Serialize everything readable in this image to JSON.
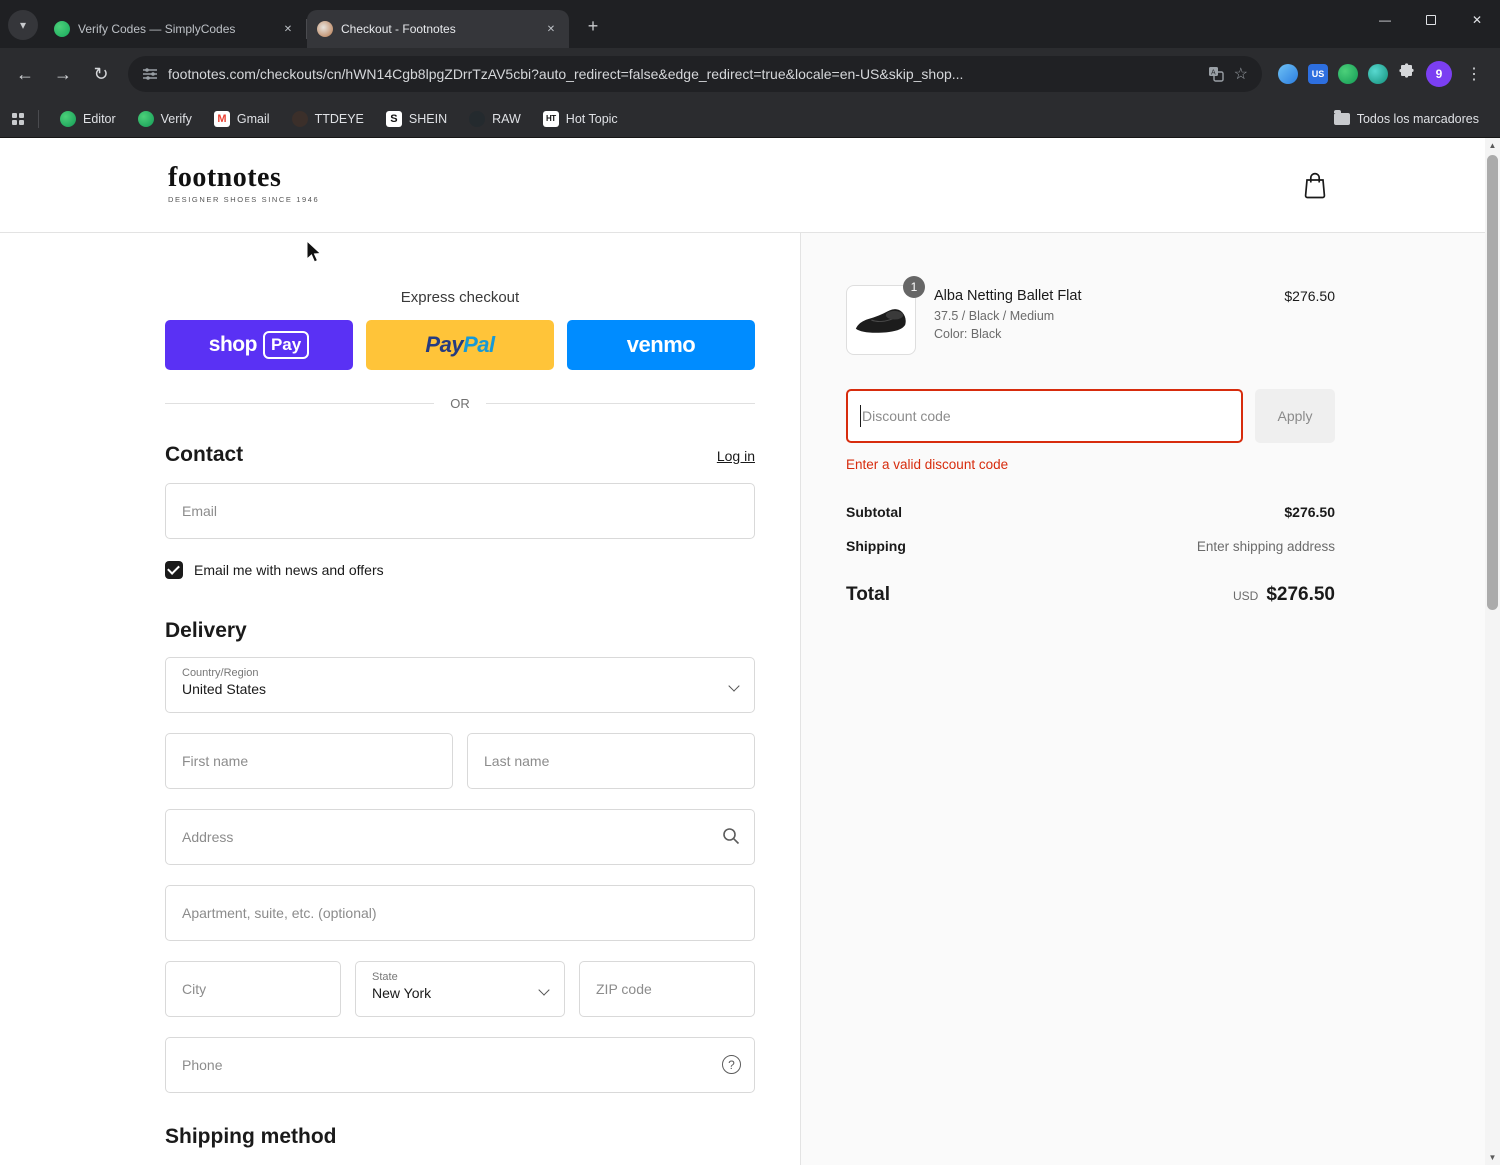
{
  "icons": {
    "tab_search": "▾",
    "tab_close": "✕",
    "new_tab": "+",
    "minimize": "—",
    "close_window": "✕",
    "back": "←",
    "forward": "→",
    "reload": "↻",
    "star": "☆",
    "menu": "⋮",
    "question": "?",
    "scroll_up": "▲",
    "scroll_down": "▼"
  },
  "browser": {
    "tabs": [
      {
        "title": "Verify Codes — SimplyCodes"
      },
      {
        "title": "Checkout - Footnotes"
      }
    ],
    "url": "footnotes.com/checkouts/cn/hWN14Cgb8lpgZDrrTzAV5cbi?auto_redirect=false&edge_redirect=true&locale=en-US&skip_shop...",
    "ext_us_badge": "US",
    "profile_badge": "9",
    "bookmarks": [
      {
        "label": "Editor",
        "letter": ""
      },
      {
        "label": "Verify",
        "letter": ""
      },
      {
        "label": "Gmail",
        "letter": "M"
      },
      {
        "label": "TTDEYE",
        "letter": ""
      },
      {
        "label": "SHEIN",
        "letter": "S"
      },
      {
        "label": "RAW",
        "letter": ""
      },
      {
        "label": "Hot Topic",
        "letter": "HT"
      }
    ],
    "bookmarks_right": "Todos los marcadores"
  },
  "header": {
    "logo": "footnotes",
    "tagline": "DESIGNER SHOES SINCE 1946"
  },
  "checkout": {
    "express_label": "Express checkout",
    "express": {
      "shop": "shop",
      "shop_pay": "Pay",
      "paypal_1": "Pay",
      "paypal_2": "Pal",
      "venmo": "venmo"
    },
    "or_label": "OR",
    "contact": {
      "heading": "Contact",
      "login": "Log in",
      "email_placeholder": "Email",
      "newsletter": "Email me with news and offers"
    },
    "delivery": {
      "heading": "Delivery",
      "country_label": "Country/Region",
      "country_value": "United States",
      "first_name_placeholder": "First name",
      "last_name_placeholder": "Last name",
      "address_placeholder": "Address",
      "apartment_placeholder": "Apartment, suite, etc. (optional)",
      "city_placeholder": "City",
      "state_label": "State",
      "state_value": "New York",
      "zip_placeholder": "ZIP code",
      "phone_placeholder": "Phone"
    },
    "shipping_method_heading": "Shipping method"
  },
  "summary": {
    "item": {
      "qty": "1",
      "name": "Alba Netting Ballet Flat",
      "variant": "37.5 / Black / Medium",
      "color": "Color: Black",
      "price": "$276.50"
    },
    "discount": {
      "placeholder": "Discount code",
      "apply": "Apply",
      "error": "Enter a valid discount code"
    },
    "subtotal_label": "Subtotal",
    "subtotal_value": "$276.50",
    "shipping_label": "Shipping",
    "shipping_value": "Enter shipping address",
    "total_label": "Total",
    "total_currency": "USD",
    "total_value": "$276.50"
  },
  "colors": {
    "shop_pay": "#5a31f4",
    "paypal": "#ffc439",
    "venmo": "#008cff",
    "error": "#d72c0d"
  }
}
